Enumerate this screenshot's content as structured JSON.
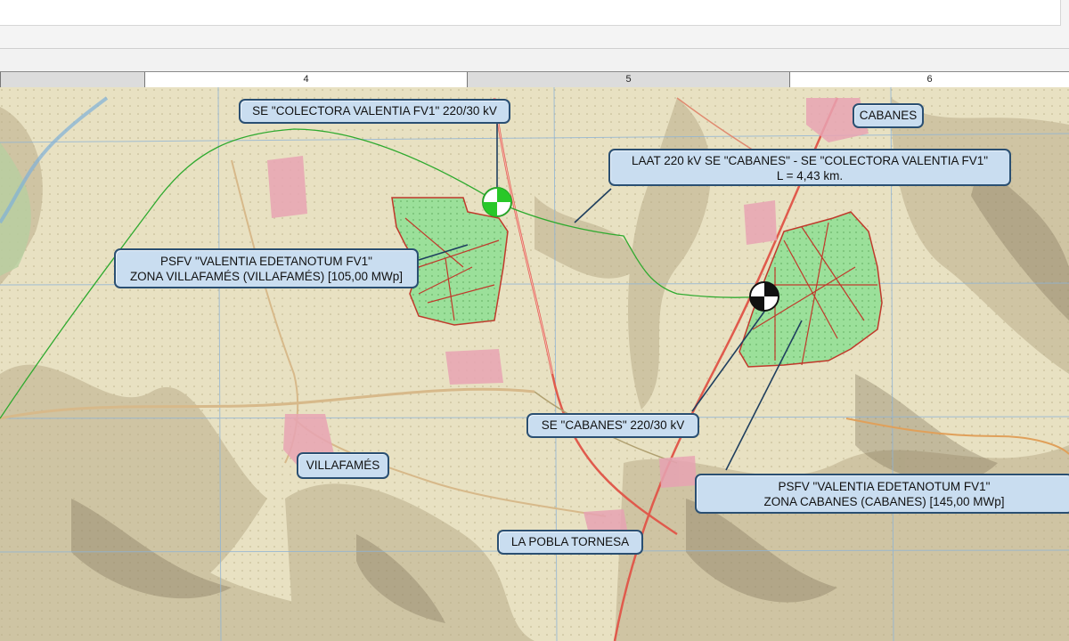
{
  "ruler": {
    "labels": [
      "4",
      "5",
      "6"
    ]
  },
  "map": {
    "callouts": {
      "se_colectora": "SE \"COLECTORA VALENTIA FV1\" 220/30 kV",
      "cabanes_town": "CABANES",
      "laat_line1": "LAAT 220 kV SE \"CABANES\" - SE \"COLECTORA VALENTIA FV1\"",
      "laat_line2": "L = 4,43 km.",
      "psfv_villafames_line1": "PSFV \"VALENTIA EDETANOTUM FV1\"",
      "psfv_villafames_line2": "ZONA VILLAFAMÉS (VILLAFAMÉS) [105,00 MWp]",
      "se_cabanes": "SE \"CABANES\" 220/30 kV",
      "villafames_town": "VILLAFAMÉS",
      "psfv_cabanes_line1": "PSFV \"VALENTIA EDETANOTUM FV1\"",
      "psfv_cabanes_line2": "ZONA CABANES (CABANES) [145,00 MWp]",
      "la_pobla": "LA POBLA TORNESA"
    },
    "colors": {
      "callout_fill": "#c9ddf0",
      "callout_border": "#2a4f72",
      "pv_area_fill": "#9be09a",
      "pv_area_border": "#c0392b",
      "line_green": "#2faa2f",
      "road_red": "#e05a4c"
    },
    "icons": [
      "substation-symbol-green",
      "substation-symbol-black"
    ]
  }
}
